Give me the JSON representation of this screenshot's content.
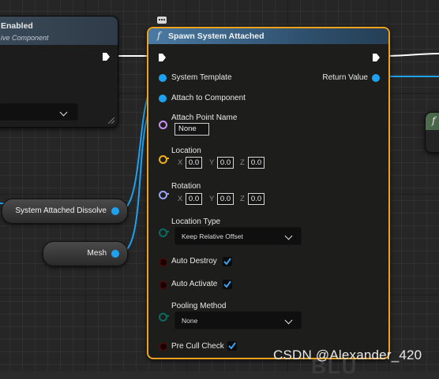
{
  "left_node": {
    "title": "Enabled",
    "subtitle": "ive Component"
  },
  "main_node": {
    "title": "Spawn System Attached",
    "function_icon": "f",
    "inputs": {
      "system_template": "System Template",
      "attach_to_component": "Attach to Component",
      "attach_point_name": "Attach Point Name",
      "attach_point_value": "None",
      "location": "Location",
      "location_values": {
        "x": "0.0",
        "y": "0.0",
        "z": "0.0"
      },
      "rotation": "Rotation",
      "rotation_values": {
        "x": "0.0",
        "y": "0.0",
        "z": "0.0"
      },
      "axis_labels": {
        "x": "X",
        "y": "Y",
        "z": "Z"
      },
      "location_type": "Location Type",
      "location_type_value": "Keep Relative Offset",
      "auto_destroy": "Auto Destroy",
      "auto_activate": "Auto Activate",
      "pooling_method": "Pooling Method",
      "pooling_method_value": "None",
      "pre_cull_check": "Pre Cull Check"
    },
    "outputs": {
      "return_value": "Return Value"
    },
    "checkboxes": {
      "auto_destroy": true,
      "auto_activate": true,
      "pre_cull_check": true
    }
  },
  "variables": {
    "dissolve": "System Attached Dissolve",
    "mesh": "Mesh"
  },
  "right_node": {
    "function_icon": "f"
  },
  "comment_icon": "...",
  "watermark": "CSDN @Alexander_420",
  "colors": {
    "exec": "#ffffff",
    "object_pin": "#1ea2f0",
    "name_pin": "#c992f0",
    "vector_pin": "#f3b012",
    "rotator_pin": "#9aa4f2",
    "enum_pin": "#0a6b62",
    "bool_pin": "#8a0000",
    "selected_outline": "#f0a21c"
  }
}
